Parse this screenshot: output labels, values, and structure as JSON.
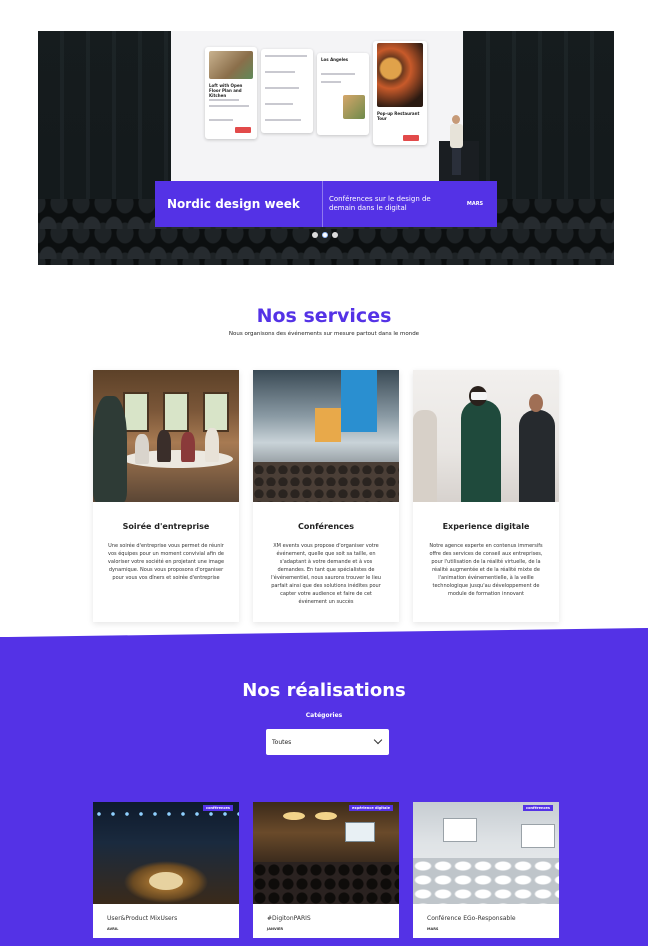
{
  "hero": {
    "title": "Nordic design week",
    "description": "Conférences sur le design de demain dans le digital",
    "date": "MARS",
    "screen": {
      "card1_title": "Loft with Open Floor Plan and Kitchen",
      "card2_title": "Los Angeles",
      "card3_title": "Pop-up Restaurant Tour"
    },
    "slides": 3,
    "active_slide": 2
  },
  "services": {
    "title": "Nos services",
    "subtitle": "Nous organisons des événements sur mesure partout dans le monde",
    "items": [
      {
        "title": "Soirée d'entreprise",
        "text": "Une soirée d'entreprise vous permet de réunir vos équipes pour un moment convivial afin de valoriser votre société en projetant une image dynamique. Nous vous proposons d'organiser pour vous vos dîners et soirée d'entreprise"
      },
      {
        "title": "Conférences",
        "text": "XM events vous propose d'organiser votre événement, quelle que soit sa taille, en s'adaptant à votre demande et à vos demandes. En tant que spécialistes de l'événementiel, nous saurons trouver le lieu parfait ainsi que des solutions inédites pour capter votre audience et faire de cet événement un succès"
      },
      {
        "title": "Experience digitale",
        "text": "Notre agence experte en contenus immersifs offre des services de conseil aux entreprises, pour l'utilisation de la réalité virtuelle, de la réalité augmentée et de la réalité mixte de l'animation événementielle, à la veille technologique jusqu'au développement de module de formation innovant"
      }
    ]
  },
  "realisations": {
    "title": "Nos réalisations",
    "categories_label": "Catégories",
    "select_value": "Toutes",
    "items": [
      {
        "title": "User&Product MixUsers",
        "date": "AVRIL",
        "tag": "conférences"
      },
      {
        "title": "#DigitonPARIS",
        "date": "JANVIER",
        "tag": "expérience digitale"
      },
      {
        "title": "Conférence EGo-Responsable",
        "date": "MARS",
        "tag": "conférences"
      }
    ]
  },
  "colors": {
    "brand_purple": "#5432e6",
    "text_dark": "#222222"
  }
}
